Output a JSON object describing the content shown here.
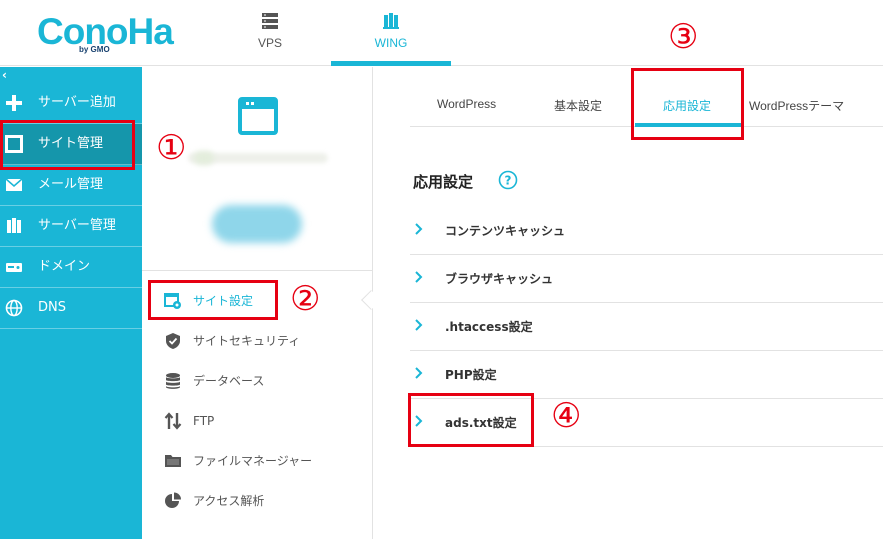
{
  "header": {
    "logo": "ConoHa",
    "logo_sub": "by GMO",
    "tabs": [
      {
        "label": "VPS",
        "icon": "server-icon"
      },
      {
        "label": "WING",
        "icon": "wing-icon",
        "active": true
      }
    ]
  },
  "sidebar": {
    "collapse": "‹",
    "items": [
      {
        "label": "サーバー追加",
        "icon": "plus-icon"
      },
      {
        "label": "サイト管理",
        "icon": "window-icon",
        "active": true
      },
      {
        "label": "メール管理",
        "icon": "envelope-icon"
      },
      {
        "label": "サーバー管理",
        "icon": "server-stack-icon"
      },
      {
        "label": "ドメイン",
        "icon": "domain-icon"
      },
      {
        "label": "DNS",
        "icon": "globe-icon"
      }
    ]
  },
  "site_menu": {
    "items": [
      {
        "label": "サイト設定",
        "icon": "site-settings-icon",
        "active": true
      },
      {
        "label": "サイトセキュリティ",
        "icon": "shield-icon"
      },
      {
        "label": "データベース",
        "icon": "database-icon"
      },
      {
        "label": "FTP",
        "icon": "ftp-arrows-icon"
      },
      {
        "label": "ファイルマネージャー",
        "icon": "folder-icon"
      },
      {
        "label": "アクセス解析",
        "icon": "pie-chart-icon"
      }
    ]
  },
  "content": {
    "tabs": [
      {
        "label": "WordPress"
      },
      {
        "label": "基本設定"
      },
      {
        "label": "応用設定",
        "active": true
      },
      {
        "label": "WordPressテーマ"
      }
    ],
    "title": "応用設定",
    "help": "?",
    "items": [
      {
        "label": "コンテンツキャッシュ"
      },
      {
        "label": "ブラウザキャッシュ"
      },
      {
        "label": ".htaccess設定"
      },
      {
        "label": "PHP設定"
      },
      {
        "label": "ads.txt設定"
      }
    ]
  },
  "annotations": [
    "①",
    "②",
    "③",
    "④"
  ],
  "colors": {
    "accent": "#1ab6d6",
    "sidebar_active": "#1596ab",
    "annotation": "#e60012"
  }
}
